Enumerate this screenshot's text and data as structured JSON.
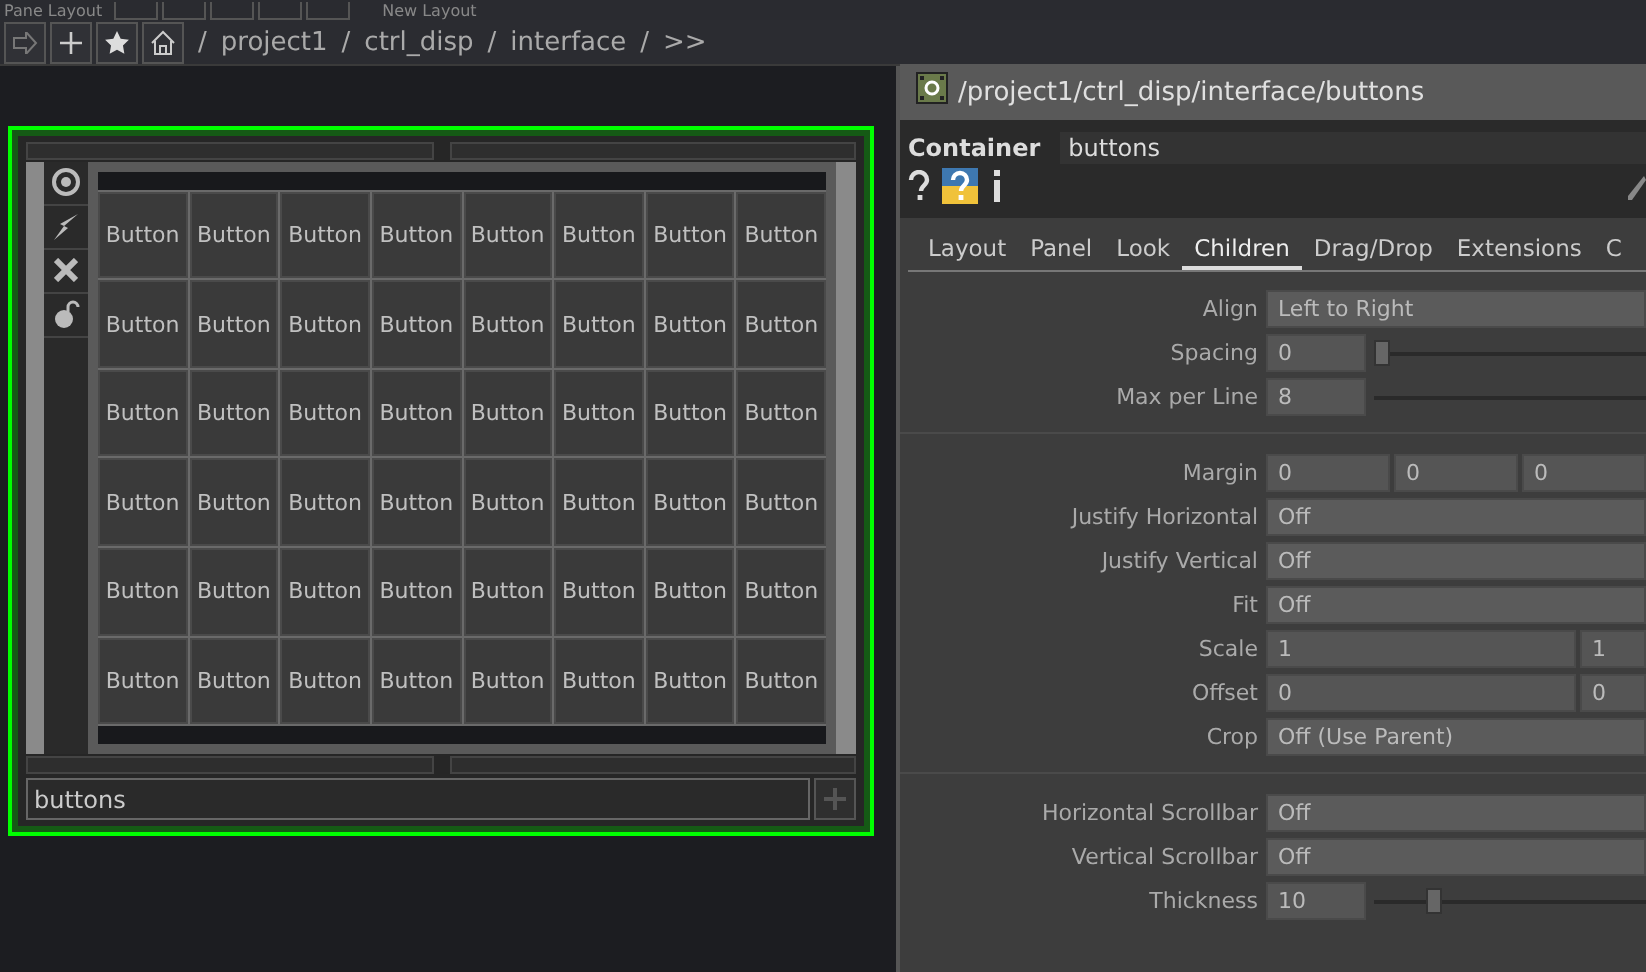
{
  "top_bar": {
    "pane_layout_label": "Pane Layout",
    "new_layout_label": "New Layout"
  },
  "path_bar": {
    "segments": [
      "/",
      "project1",
      "/",
      "ctrl_disp",
      "/",
      "interface",
      "/",
      ">>"
    ]
  },
  "panel": {
    "grid_rows": [
      [
        "Button",
        "Button",
        "Button",
        "Button",
        "Button",
        "Button",
        "Button",
        "Button"
      ],
      [
        "Button",
        "Button",
        "Button",
        "Button",
        "Button",
        "Button",
        "Button",
        "Button"
      ],
      [
        "Button",
        "Button",
        "Button",
        "Button",
        "Button",
        "Button",
        "Button",
        "Button"
      ],
      [
        "Button",
        "Button",
        "Button",
        "Button",
        "Button",
        "Button",
        "Button",
        "Button"
      ],
      [
        "Button",
        "Button",
        "Button",
        "Button",
        "Button",
        "Button",
        "Button",
        "Button"
      ],
      [
        "Button",
        "Button",
        "Button",
        "Button",
        "Button",
        "Button",
        "Button",
        "Button"
      ]
    ],
    "name_field": "buttons"
  },
  "parameter_window": {
    "title": "/project1/ctrl_disp/interface/buttons",
    "op_type": "Container",
    "op_name": "buttons",
    "tabs": [
      {
        "label": "Layout",
        "selected": false
      },
      {
        "label": "Panel",
        "selected": false
      },
      {
        "label": "Look",
        "selected": false
      },
      {
        "label": "Children",
        "selected": true
      },
      {
        "label": "Drag/Drop",
        "selected": false
      },
      {
        "label": "Extensions",
        "selected": false
      },
      {
        "label": "C",
        "selected": false
      }
    ],
    "groups": [
      [
        {
          "kind": "menu",
          "label": "Align",
          "value": "Left to Right"
        },
        {
          "kind": "slider",
          "label": "Spacing",
          "value": "0",
          "level": 0
        },
        {
          "kind": "numeric",
          "label": "Max per Line",
          "value": "8"
        }
      ],
      [
        {
          "kind": "multi",
          "label": "Margin",
          "values": [
            "0",
            "0",
            "0"
          ]
        },
        {
          "kind": "menu",
          "label": "Justify Horizontal",
          "value": "Off"
        },
        {
          "kind": "menu",
          "label": "Justify Vertical",
          "value": "Off"
        },
        {
          "kind": "menu",
          "label": "Fit",
          "value": "Off"
        },
        {
          "kind": "pair",
          "label": "Scale",
          "values": [
            "1",
            "1"
          ]
        },
        {
          "kind": "pair",
          "label": "Offset",
          "values": [
            "0",
            "0"
          ]
        },
        {
          "kind": "menu",
          "label": "Crop",
          "value": "Off (Use Parent)"
        }
      ],
      [
        {
          "kind": "menu",
          "label": "Horizontal Scrollbar",
          "value": "Off"
        },
        {
          "kind": "menu",
          "label": "Vertical Scrollbar",
          "value": "Off"
        },
        {
          "kind": "slider",
          "label": "Thickness",
          "value": "10",
          "level": 0.19
        }
      ]
    ]
  }
}
